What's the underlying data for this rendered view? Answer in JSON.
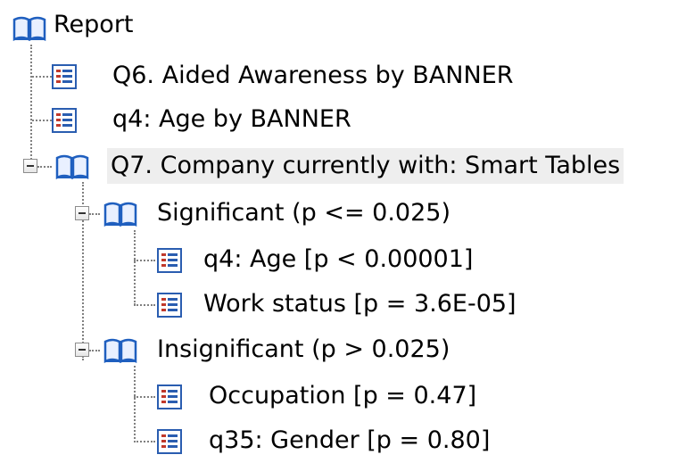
{
  "tree": {
    "root": {
      "label": "Report",
      "icon": "book-icon"
    },
    "items": [
      {
        "label": "Q6. Aided Awareness by BANNER",
        "icon": "table-icon"
      },
      {
        "label": "q4: Age by BANNER",
        "icon": "table-icon"
      },
      {
        "label": "Q7. Company currently with: Smart Tables",
        "icon": "book-icon",
        "expanded": true,
        "selected": true,
        "groups": [
          {
            "label": "Significant (p <= 0.025)",
            "icon": "book-icon",
            "expanded": true,
            "children": [
              {
                "label": "q4: Age [p < 0.00001]",
                "icon": "table-icon"
              },
              {
                "label": "Work status [p = 3.6E-05]",
                "icon": "table-icon"
              }
            ]
          },
          {
            "label": "Insignificant (p > 0.025)",
            "icon": "book-icon",
            "expanded": true,
            "children": [
              {
                "label": "Occupation [p = 0.47]",
                "icon": "table-icon"
              },
              {
                "label": "q35: Gender [p = 0.80]",
                "icon": "table-icon"
              }
            ]
          }
        ]
      }
    ]
  },
  "colors": {
    "book_blue": "#1f5fbf",
    "table_red": "#c0392b",
    "table_blue": "#2a5db0",
    "selection": "#eeeeee",
    "connector": "#808080"
  }
}
